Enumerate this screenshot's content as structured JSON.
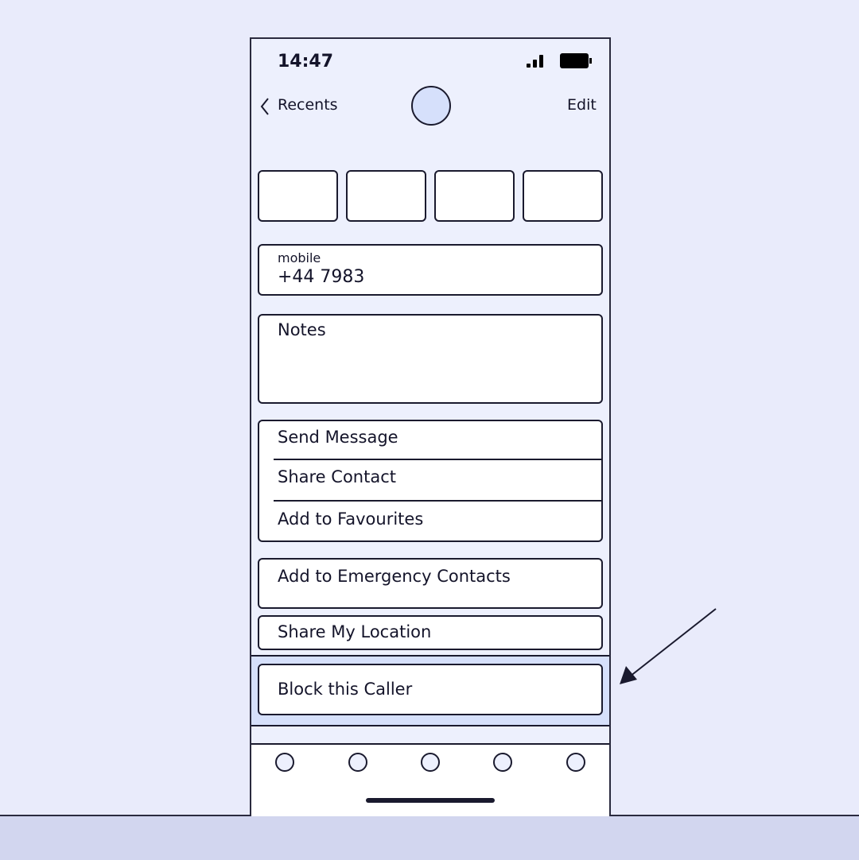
{
  "status_bar": {
    "time": "14:47",
    "signal_icon": "signal-icon",
    "battery_icon": "battery-icon"
  },
  "nav": {
    "back_label": "Recents",
    "edit_label": "Edit"
  },
  "contact": {
    "phone_label": "mobile",
    "phone_value": "+44 7983",
    "notes_label": "Notes"
  },
  "actions": [
    "Send Message",
    "Share Contact",
    "Add to Favourites"
  ],
  "emergency_label": "Add to Emergency Contacts",
  "location_label": "Share My Location",
  "block_label": "Block this Caller",
  "colors": {
    "background": "#e9ebfb",
    "highlight": "#d6e0fb",
    "avatar": "#d6e0fb",
    "stroke": "#1a1a2e"
  }
}
